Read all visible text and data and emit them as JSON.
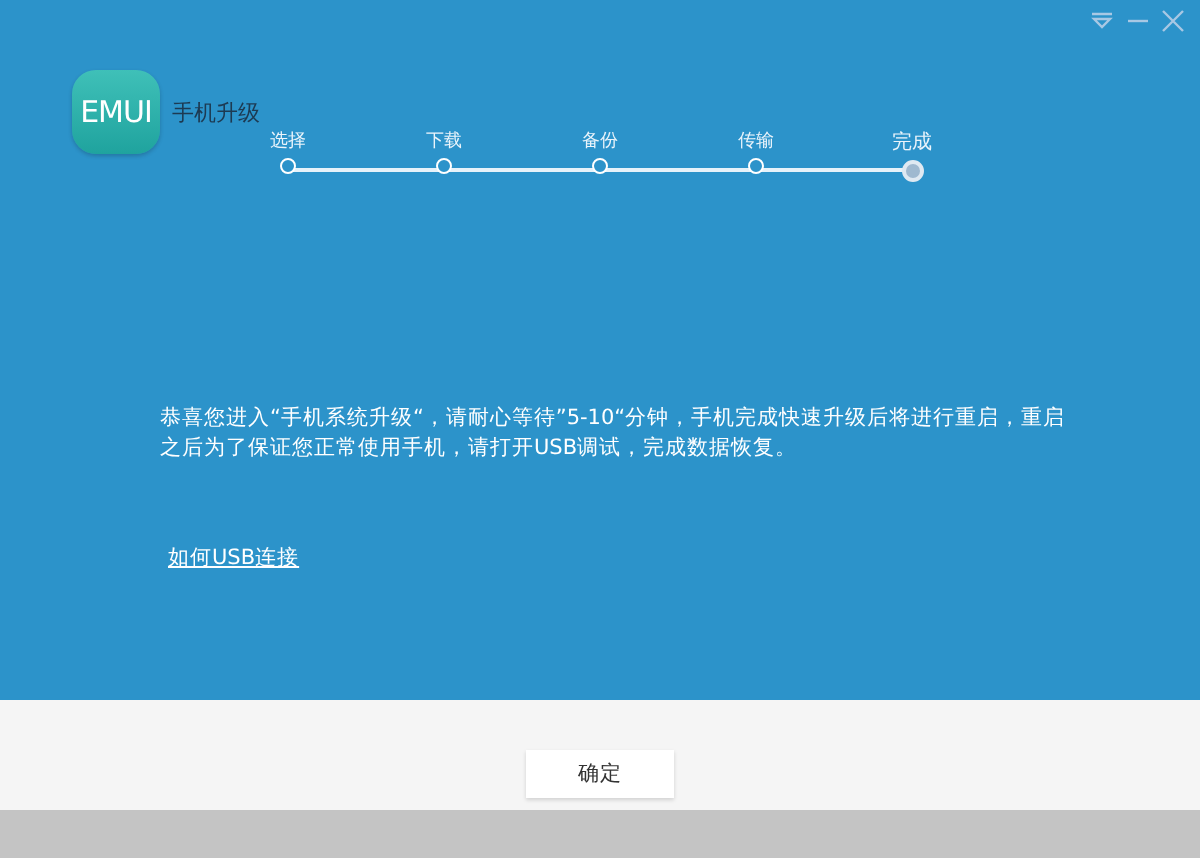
{
  "app": {
    "logo_text": "EMUI",
    "title": "手机升级"
  },
  "steps": [
    {
      "label": "选择",
      "selected": false
    },
    {
      "label": "下载",
      "selected": false
    },
    {
      "label": "备份",
      "selected": false
    },
    {
      "label": "传输",
      "selected": false
    },
    {
      "label": "完成",
      "selected": true
    }
  ],
  "message": "恭喜您进入“手机系统升级“，请耐心等待”5-10“分钟，手机完成快速升级后将进行重启，重启之后为了保证您正常使用手机，请打开USB调试，完成数据恢复。",
  "help_link": "如何USB连接",
  "buttons": [
    "确定"
  ]
}
